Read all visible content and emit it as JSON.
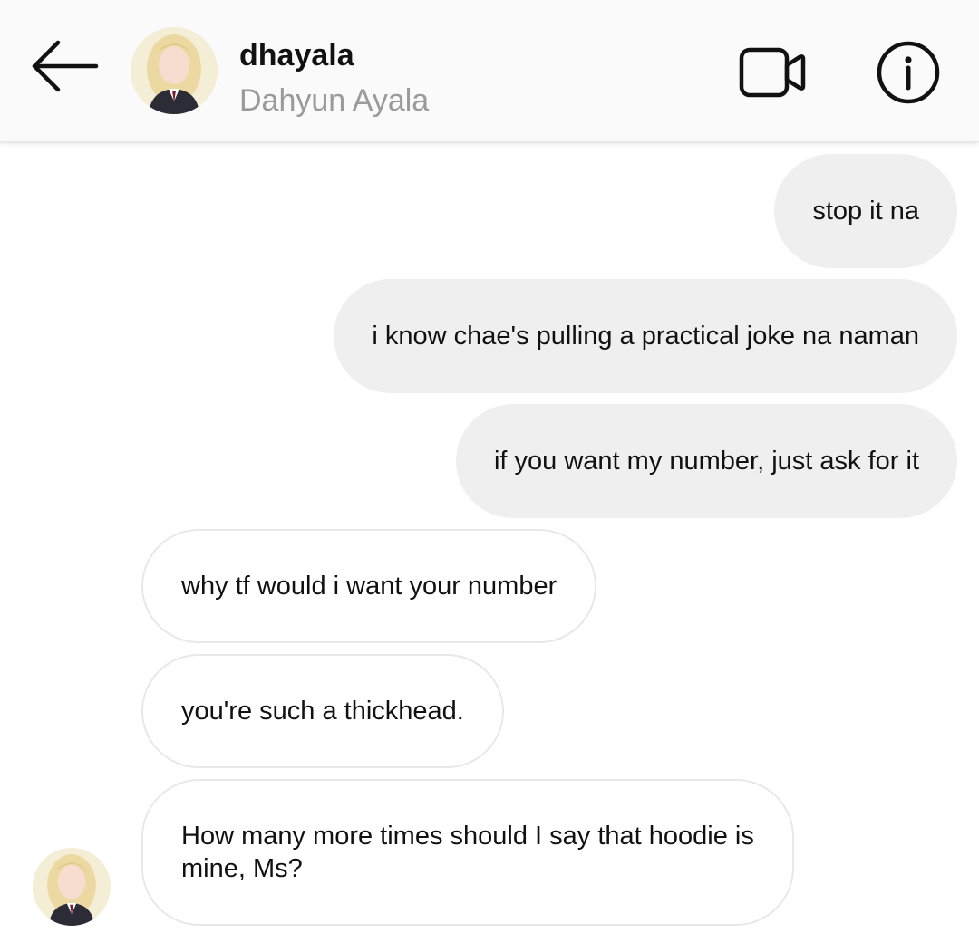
{
  "header": {
    "username": "dhayala",
    "display_name": "Dahyun Ayala",
    "back_icon": "arrow-left-icon",
    "video_icon": "video-camera-icon",
    "info_icon": "info-icon"
  },
  "messages": [
    {
      "direction": "sent",
      "text": "stop it na"
    },
    {
      "direction": "sent",
      "text": "i know chae's pulling a practical joke na naman"
    },
    {
      "direction": "sent",
      "text": "if you  want my number, just ask for it"
    },
    {
      "direction": "received",
      "text": "why tf would i want your number"
    },
    {
      "direction": "received",
      "text": "you're such a thickhead."
    },
    {
      "direction": "received",
      "text": "How many more times should I say that hoodie is mine, Ms?"
    }
  ],
  "colors": {
    "sent_bubble": "#efefef",
    "received_border": "#e8e8e8",
    "secondary_text": "#9a9a9a"
  }
}
